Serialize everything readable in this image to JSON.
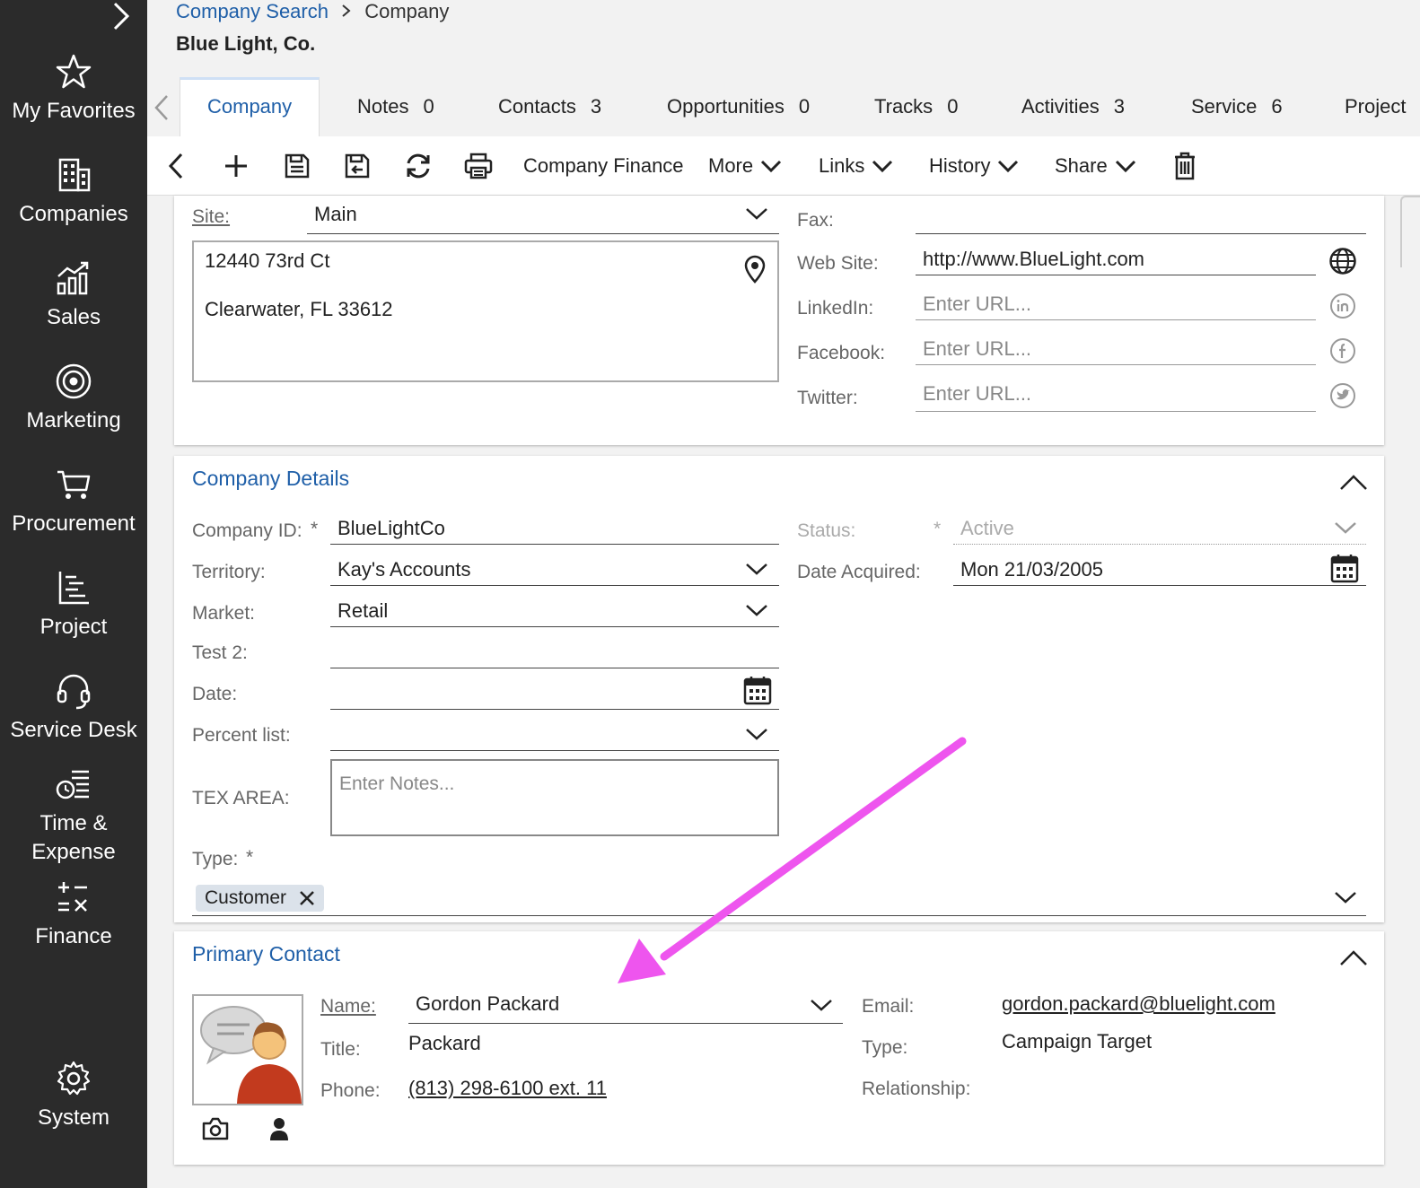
{
  "sidebar": {
    "items": [
      {
        "label": "My Favorites",
        "icon": "star-icon"
      },
      {
        "label": "Companies",
        "icon": "building-icon"
      },
      {
        "label": "Sales",
        "icon": "sales-chart-icon"
      },
      {
        "label": "Marketing",
        "icon": "target-icon"
      },
      {
        "label": "Procurement",
        "icon": "cart-icon"
      },
      {
        "label": "Project",
        "icon": "project-icon"
      },
      {
        "label": "Service Desk",
        "icon": "headset-icon"
      },
      {
        "label": "Time &",
        "label2": "Expense",
        "icon": "time-expense-icon"
      },
      {
        "label": "Finance",
        "icon": "finance-icon"
      },
      {
        "label": "System",
        "icon": "gear-icon"
      }
    ]
  },
  "breadcrumb": {
    "link": "Company Search",
    "current": "Company"
  },
  "page_title": "Blue Light, Co.",
  "tabs": [
    {
      "label": "Company",
      "count": ""
    },
    {
      "label": "Notes",
      "count": "0"
    },
    {
      "label": "Contacts",
      "count": "3"
    },
    {
      "label": "Opportunities",
      "count": "0"
    },
    {
      "label": "Tracks",
      "count": "0"
    },
    {
      "label": "Activities",
      "count": "3"
    },
    {
      "label": "Service",
      "count": "6"
    },
    {
      "label": "Project",
      "count": ""
    }
  ],
  "toolbar": {
    "company_finance": "Company Finance",
    "more": "More",
    "links": "Links",
    "history": "History",
    "share": "Share"
  },
  "address": {
    "site_label": "Site:",
    "site_value": "Main",
    "line1": "12440 73rd Ct",
    "line2": "Clearwater, FL 33612"
  },
  "web": {
    "fax_label": "Fax:",
    "fax_value": "",
    "website_label": "Web Site:",
    "website_value": "http://www.BlueLight.com",
    "linkedin_label": "LinkedIn:",
    "facebook_label": "Facebook:",
    "twitter_label": "Twitter:",
    "url_placeholder": "Enter URL..."
  },
  "details": {
    "title": "Company Details",
    "company_id_label": "Company ID:",
    "company_id_value": "BlueLightCo",
    "territory_label": "Territory:",
    "territory_value": "Kay's Accounts",
    "market_label": "Market:",
    "market_value": "Retail",
    "test2_label": "Test 2:",
    "date_label": "Date:",
    "percent_label": "Percent list:",
    "tex_label": "TEX AREA:",
    "notes_placeholder": "Enter Notes...",
    "type_label": "Type:",
    "type_chip": "Customer",
    "status_label": "Status:",
    "status_value": "Active",
    "date_acquired_label": "Date Acquired:",
    "date_acquired_value": "Mon 21/03/2005",
    "required_mark": "*"
  },
  "primary_contact": {
    "title": "Primary Contact",
    "name_label": "Name:",
    "name_value": "Gordon Packard",
    "title_label": "Title:",
    "title_value": "Packard",
    "phone_label": "Phone:",
    "phone_value": "(813) 298-6100 ext. 11",
    "email_label": "Email:",
    "email_value": "gordon.packard@bluelight.com",
    "type_label": "Type:",
    "type_value": "Campaign Target",
    "relationship_label": "Relationship:"
  },
  "colors": {
    "accent": "#1f5fa8",
    "sidebar": "#2b2b2b",
    "arrow": "#ee55ee"
  }
}
